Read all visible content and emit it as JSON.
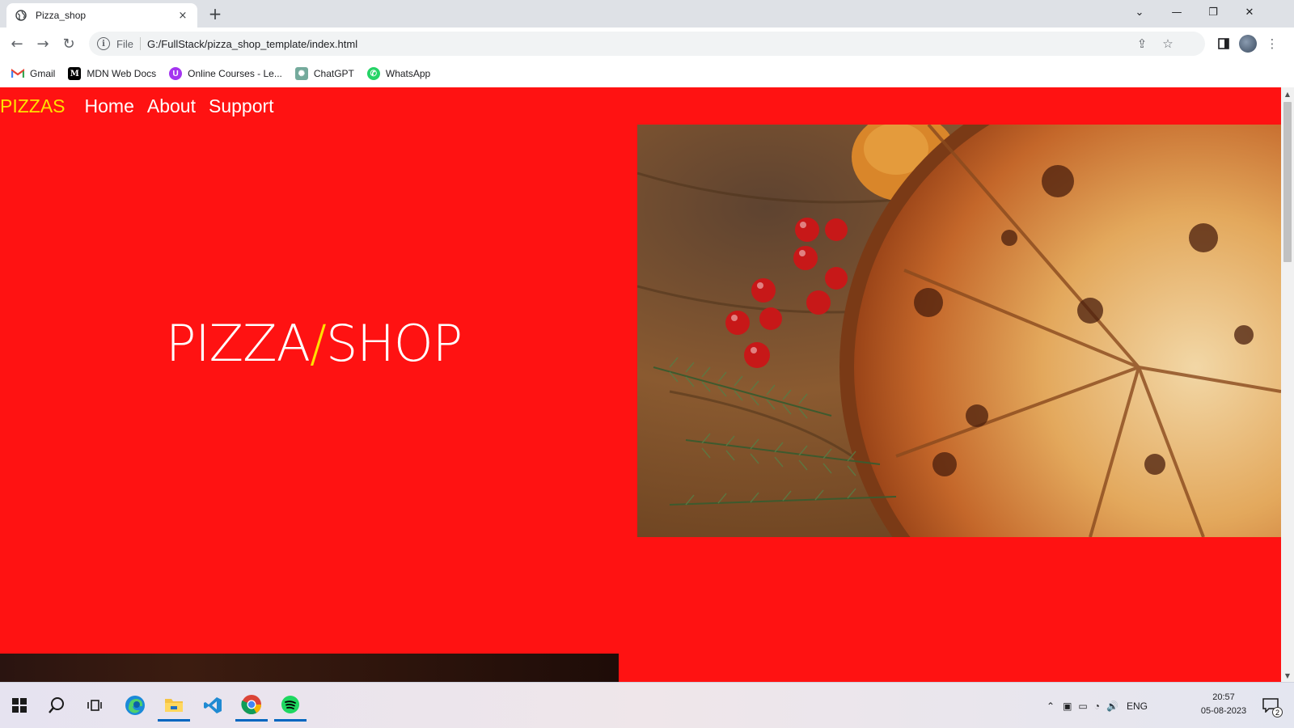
{
  "tab": {
    "title": "Pizza_shop",
    "close": "×",
    "new_tab": "+"
  },
  "window_controls": {
    "dropdown": "⌄",
    "minimize": "—",
    "restore": "❐",
    "close": "✕"
  },
  "toolbar": {
    "back": "←",
    "forward": "→",
    "reload": "↻",
    "scheme": "File",
    "url": "G:/FullStack/pizza_shop_template/index.html"
  },
  "bookmarks": [
    {
      "label": "Gmail",
      "icon": "gmail-icon"
    },
    {
      "label": "MDN Web Docs",
      "icon": "mdn-icon"
    },
    {
      "label": "Online Courses - Le...",
      "icon": "udemy-icon"
    },
    {
      "label": "ChatGPT",
      "icon": "chatgpt-icon"
    },
    {
      "label": "WhatsApp",
      "icon": "whatsapp-icon"
    }
  ],
  "site": {
    "brand": "PIZZAS",
    "nav": [
      "Home",
      "About",
      "Support"
    ],
    "hero": {
      "left": "PIZZA",
      "slash": "/",
      "right": "SHOP"
    }
  },
  "taskbar": {
    "language": "ENG",
    "time": "20:57",
    "date": "05-08-2023",
    "notifications": "2"
  },
  "colors": {
    "page_background": "#ff1212",
    "accent_yellow": "#ffe100"
  }
}
